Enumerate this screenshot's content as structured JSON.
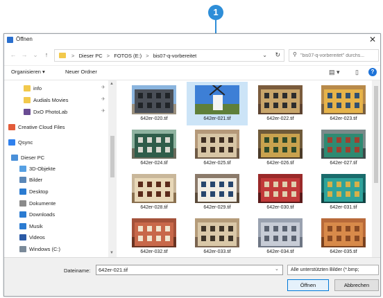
{
  "callout": {
    "number": "1"
  },
  "window": {
    "title": "Öffnen",
    "close": "✕"
  },
  "nav": {
    "back": "←",
    "forward": "→",
    "down": "⌄",
    "up": "↑"
  },
  "address": {
    "crumbs": [
      "Dieser PC",
      "FOTOS (E:)",
      "bis07-q-vorbereitet"
    ],
    "separator": ">",
    "chevron": "⌄",
    "refresh": "↻"
  },
  "search": {
    "placeholder": "\"bis07-q-vorbereitet\" durchs..."
  },
  "toolbar": {
    "organize": "Organisieren ▾",
    "new_folder": "Neuer Ordner",
    "view": "▤ ▾",
    "pane": "▯",
    "help": "?"
  },
  "sidebar": {
    "items": [
      {
        "label": "info",
        "icon": "folder-icon",
        "color": "#f2c94c"
      },
      {
        "label": "Audials Movies",
        "icon": "folder-icon",
        "color": "#f2c94c"
      },
      {
        "label": "DxO PhotoLab",
        "icon": "app-icon",
        "color": "#6a4c93"
      },
      {
        "label": "Creative Cloud Files",
        "icon": "cloud-icon",
        "color": "#e35c3a"
      },
      {
        "label": "Qsync",
        "icon": "sync-icon",
        "color": "#2f80ed"
      },
      {
        "label": "Dieser PC",
        "icon": "computer-icon",
        "color": "#4a90d9"
      },
      {
        "label": "3D-Objekte",
        "icon": "cube-icon",
        "color": "#56a0e3"
      },
      {
        "label": "Bilder",
        "icon": "pictures-icon",
        "color": "#5a87b8"
      },
      {
        "label": "Desktop",
        "icon": "desktop-icon",
        "color": "#2b7bd1"
      },
      {
        "label": "Dokumente",
        "icon": "documents-icon",
        "color": "#8a8a8a"
      },
      {
        "label": "Downloads",
        "icon": "download-icon",
        "color": "#2b7bd1"
      },
      {
        "label": "Musik",
        "icon": "music-icon",
        "color": "#2b7bd1"
      },
      {
        "label": "Videos",
        "icon": "video-icon",
        "color": "#2b5aa6"
      },
      {
        "label": "Windows (C:)",
        "icon": "drive-icon",
        "color": "#7a8a99"
      }
    ],
    "pin": "✈"
  },
  "files": [
    {
      "name": "642er-020.tif",
      "selected": false
    },
    {
      "name": "642er-021.tif",
      "selected": true
    },
    {
      "name": "642er-022.tif",
      "selected": false
    },
    {
      "name": "642er-023.tif",
      "selected": false
    },
    {
      "name": "642er-024.tif",
      "selected": false
    },
    {
      "name": "642er-025.tif",
      "selected": false
    },
    {
      "name": "642er-026.tif",
      "selected": false
    },
    {
      "name": "642er-027.tif",
      "selected": false
    },
    {
      "name": "642er-028.tif",
      "selected": false
    },
    {
      "name": "642er-029.tif",
      "selected": false
    },
    {
      "name": "642er-030.tif",
      "selected": false
    },
    {
      "name": "642er-031.tif",
      "selected": false
    },
    {
      "name": "642er-032.tif",
      "selected": false
    },
    {
      "name": "642er-033.tif",
      "selected": false
    },
    {
      "name": "642er-034.tif",
      "selected": false
    },
    {
      "name": "642er-035.tif",
      "selected": false
    }
  ],
  "footer": {
    "filename_label": "Dateiname:",
    "filename_value": "642er-021.tif",
    "dropdown": "⌄",
    "filetype": "Alle unterstützten Bilder (*.bmp;",
    "open": "Öffnen",
    "cancel": "Abbrechen"
  },
  "colors": {
    "accent": "#2e8ed8",
    "selection": "#cce4f7",
    "help": "#1e73d8"
  }
}
